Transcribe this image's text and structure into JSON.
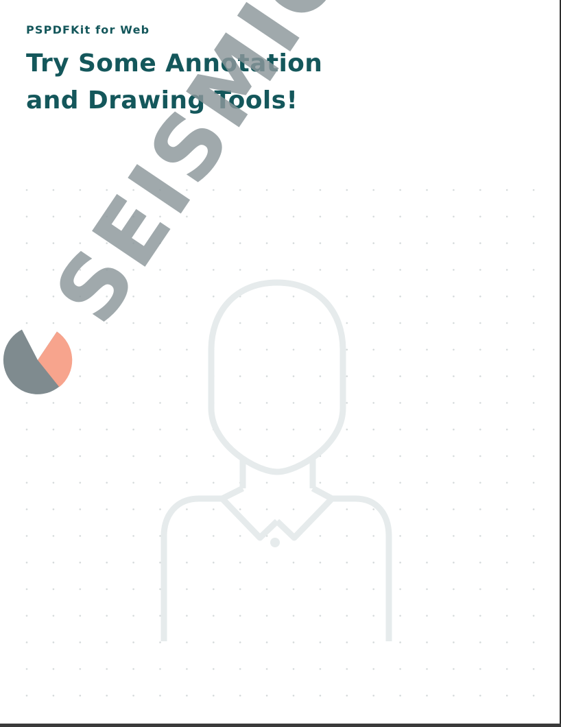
{
  "document": {
    "subtitle": "PSPDFKit for Web",
    "title_lines": [
      "Try Some Annotation",
      "and Drawing Tools!"
    ]
  },
  "watermark": {
    "text": "SEISMIC",
    "text_color": "#8c979b",
    "logo_dark_color": "#7f8b8f",
    "logo_accent_color": "#f7a48d"
  },
  "illustration": {
    "icon": "person-outline-icon",
    "stroke_color": "#e6ebec"
  },
  "background": {
    "pattern": "dot-grid",
    "dot_color": "#d6dbdc"
  },
  "colors": {
    "heading": "#14575b",
    "page": "#ffffff",
    "frame": "#3a3a3a"
  }
}
